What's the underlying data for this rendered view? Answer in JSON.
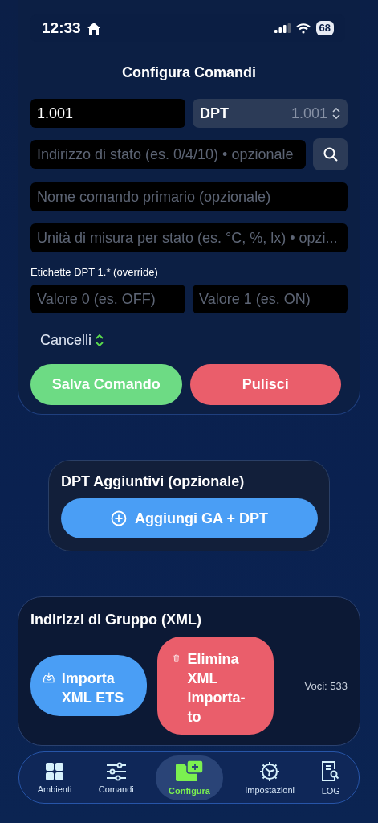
{
  "status_bar": {
    "time": "12:33",
    "battery": "68"
  },
  "header": {
    "title": "Configura Comandi"
  },
  "command_form": {
    "address": {
      "value": "1.001"
    },
    "dpt_select": {
      "label": "DPT",
      "value": "1.001"
    },
    "status_address": {
      "placeholder": "Indirizzo di stato (es. 0/4/10) • opzionale"
    },
    "name": {
      "placeholder": "Nome comando primario (opzionale)"
    },
    "unit": {
      "placeholder": "Unità di misura per stato (es. °C, %, lx) • opzi..."
    },
    "labels_title": "Etichette DPT 1.* (override)",
    "value_fields": [
      {
        "placeholder": "Valore 0 (es. OFF)"
      },
      {
        "placeholder": "Valore 1 (es. ON)"
      }
    ],
    "category": {
      "value": "Cancelli"
    },
    "buttons": [
      {
        "label": "Salva Comando",
        "kind": "primary"
      },
      {
        "label": "Pulisci",
        "kind": "danger"
      }
    ]
  },
  "extra_dpt": {
    "title": "DPT Aggiuntivi (opzionale)",
    "button": "Aggiungi GA + DPT"
  },
  "group_addresses": {
    "title": "Indirizzi di Gruppo (XML)",
    "import_button": "Importa XML ETS",
    "delete_button": "Elimina XML importa-to",
    "count": "Voci: 533"
  },
  "tabs": [
    {
      "label": "Ambienti",
      "selected": false,
      "kind": "grid"
    },
    {
      "label": "Comandi",
      "selected": false,
      "kind": "sliders"
    },
    {
      "label": "Configura",
      "selected": true,
      "kind": "folder"
    },
    {
      "label": "Impostazioni",
      "selected": false,
      "kind": "gear"
    },
    {
      "label": "LOG",
      "selected": false,
      "kind": "log"
    }
  ]
}
